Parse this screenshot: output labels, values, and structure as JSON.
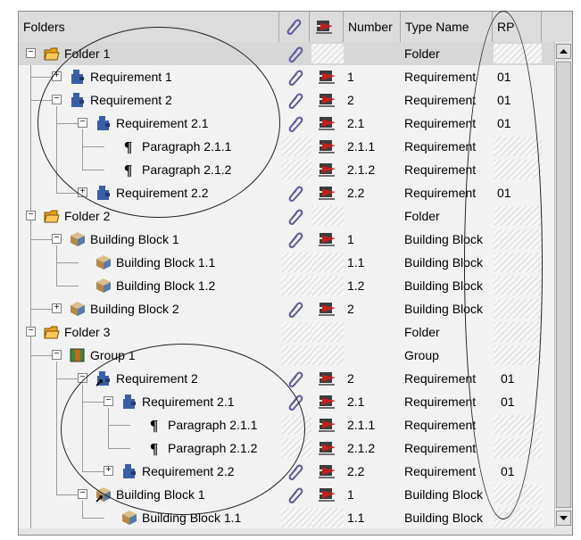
{
  "header": {
    "folders": "Folders",
    "number": "Number",
    "type_name": "Type Name",
    "rp": "RP",
    "attach_icon": "paperclip-icon",
    "server_icon": "server-icon"
  },
  "rows": [
    {
      "label": "Folder 1",
      "icon": "folder-icon",
      "exp": "−",
      "clip": true,
      "srv": false,
      "number": "",
      "type": "Folder",
      "rp": "",
      "selected": true
    },
    {
      "label": "Requirement 1",
      "icon": "requirement-icon",
      "exp": "+",
      "clip": true,
      "srv": true,
      "number": "1",
      "type": "Requirement",
      "rp": "01"
    },
    {
      "label": "Requirement 2",
      "icon": "requirement-icon",
      "exp": "−",
      "clip": true,
      "srv": true,
      "number": "2",
      "type": "Requirement",
      "rp": "01"
    },
    {
      "label": "Requirement 2.1",
      "icon": "requirement-icon",
      "exp": "−",
      "clip": true,
      "srv": true,
      "number": "2.1",
      "type": "Requirement",
      "rp": "01"
    },
    {
      "label": "Paragraph 2.1.1",
      "icon": "pilcrow-icon",
      "exp": "",
      "clip": false,
      "srv": true,
      "number": "2.1.1",
      "type": "Requirement",
      "rp": ""
    },
    {
      "label": "Paragraph 2.1.2",
      "icon": "pilcrow-icon",
      "exp": "",
      "clip": false,
      "srv": true,
      "number": "2.1.2",
      "type": "Requirement",
      "rp": ""
    },
    {
      "label": "Requirement 2.2",
      "icon": "requirement-icon",
      "exp": "+",
      "clip": true,
      "srv": true,
      "number": "2.2",
      "type": "Requirement",
      "rp": "01"
    },
    {
      "label": "Folder 2",
      "icon": "folder-icon",
      "exp": "−",
      "clip": true,
      "srv": false,
      "number": "",
      "type": "Folder",
      "rp": ""
    },
    {
      "label": "Building Block 1",
      "icon": "building-block-icon",
      "exp": "−",
      "clip": true,
      "srv": true,
      "number": "1",
      "type": "Building Block",
      "rp": ""
    },
    {
      "label": "Building Block 1.1",
      "icon": "building-block-icon",
      "exp": "",
      "clip": false,
      "srv": false,
      "number": "1.1",
      "type": "Building Block",
      "rp": ""
    },
    {
      "label": "Building Block 1.2",
      "icon": "building-block-icon",
      "exp": "",
      "clip": false,
      "srv": false,
      "number": "1.2",
      "type": "Building Block",
      "rp": ""
    },
    {
      "label": "Building Block 2",
      "icon": "building-block-icon",
      "exp": "+",
      "clip": true,
      "srv": true,
      "number": "2",
      "type": "Building Block",
      "rp": ""
    },
    {
      "label": "Folder 3",
      "icon": "folder-icon",
      "exp": "−",
      "clip": false,
      "srv": false,
      "number": "",
      "type": "Folder",
      "rp": ""
    },
    {
      "label": "Group 1",
      "icon": "group-icon",
      "exp": "−",
      "clip": false,
      "srv": false,
      "number": "",
      "type": "Group",
      "rp": ""
    },
    {
      "label": "Requirement 2",
      "icon": "requirement-link-icon",
      "exp": "−",
      "clip": true,
      "srv": true,
      "number": "2",
      "type": "Requirement",
      "rp": "01"
    },
    {
      "label": "Requirement 2.1",
      "icon": "requirement-icon",
      "exp": "−",
      "clip": true,
      "srv": true,
      "number": "2.1",
      "type": "Requirement",
      "rp": "01"
    },
    {
      "label": "Paragraph 2.1.1",
      "icon": "pilcrow-icon",
      "exp": "",
      "clip": false,
      "srv": true,
      "number": "2.1.1",
      "type": "Requirement",
      "rp": ""
    },
    {
      "label": "Paragraph 2.1.2",
      "icon": "pilcrow-icon",
      "exp": "",
      "clip": false,
      "srv": true,
      "number": "2.1.2",
      "type": "Requirement",
      "rp": ""
    },
    {
      "label": "Requirement 2.2",
      "icon": "requirement-icon",
      "exp": "+",
      "clip": true,
      "srv": true,
      "number": "2.2",
      "type": "Requirement",
      "rp": "01"
    },
    {
      "label": "Building Block 1",
      "icon": "building-block-link-icon",
      "exp": "−",
      "clip": true,
      "srv": true,
      "number": "1",
      "type": "Building Block",
      "rp": ""
    },
    {
      "label": "Building Block 1.1",
      "icon": "building-block-icon",
      "exp": "",
      "clip": false,
      "srv": false,
      "number": "1.1",
      "type": "Building Block",
      "rp": ""
    }
  ],
  "colors": {
    "folder": "#e8a21c",
    "requirement": "#3a5fa8",
    "building_block": "#b38a4a",
    "group": "#c46a1c",
    "server_red": "#c0201c",
    "clip": "#5a5aa0"
  }
}
